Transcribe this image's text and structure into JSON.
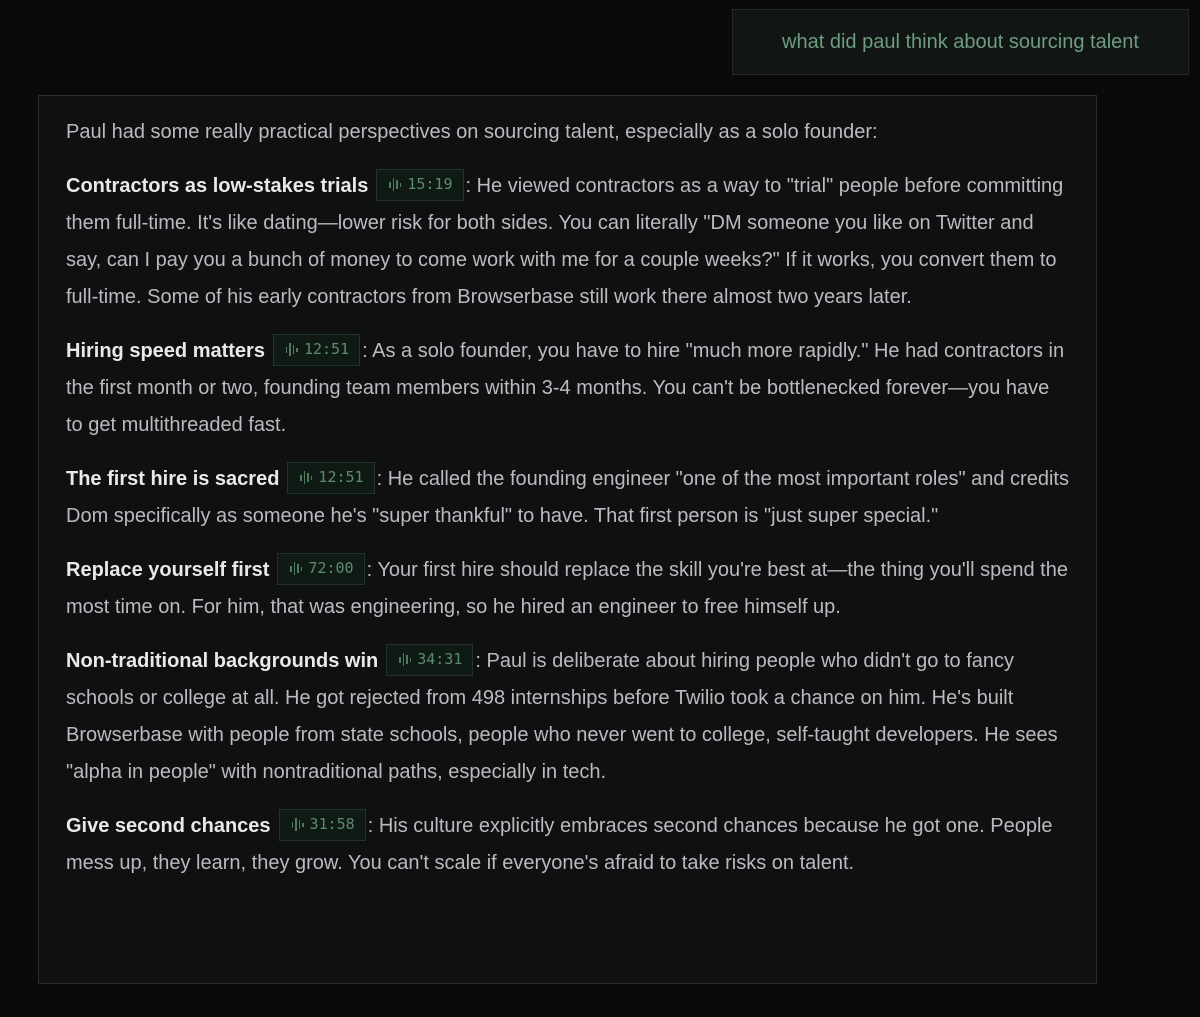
{
  "user_message": "what did paul think about sourcing talent",
  "answer": {
    "intro": "Paul had some really practical perspectives on sourcing talent, especially as a solo founder:",
    "points": [
      {
        "title": "Contractors as low-stakes trials",
        "timestamp": "15:19",
        "body": ": He viewed contractors as a way to \"trial\" people before committing them full-time. It's like dating—lower risk for both sides. You can literally \"DM someone you like on Twitter and say, can I pay you a bunch of money to come work with me for a couple weeks?\" If it works, you convert them to full-time. Some of his early contractors from Browserbase still work there almost two years later."
      },
      {
        "title": "Hiring speed matters",
        "timestamp": "12:51",
        "body": ": As a solo founder, you have to hire \"much more rapidly.\" He had contractors in the first month or two, founding team members within 3-4 months. You can't be bottlenecked forever—you have to get multithreaded fast."
      },
      {
        "title": "The first hire is sacred",
        "timestamp": "12:51",
        "body": ": He called the founding engineer \"one of the most important roles\" and credits Dom specifically as someone he's \"super thankful\" to have. That first person is \"just super special.\""
      },
      {
        "title": "Replace yourself first",
        "timestamp": "72:00",
        "body": ": Your first hire should replace the skill you're best at—the thing you'll spend the most time on. For him, that was engineering, so he hired an engineer to free himself up."
      },
      {
        "title": "Non-traditional backgrounds win",
        "timestamp": "34:31",
        "body": ": Paul is deliberate about hiring people who didn't go to fancy schools or college at all. He got rejected from 498 internships before Twilio took a chance on him. He's built Browserbase with people from state schools, people who never went to college, self-taught developers. He sees \"alpha in people\" with nontraditional paths, especially in tech."
      },
      {
        "title": "Give second chances",
        "timestamp": "31:58",
        "body": ": His culture explicitly embraces second chances because he got one. People mess up, they learn, they grow. You can't scale if everyone's afraid to take risks on talent."
      }
    ]
  }
}
